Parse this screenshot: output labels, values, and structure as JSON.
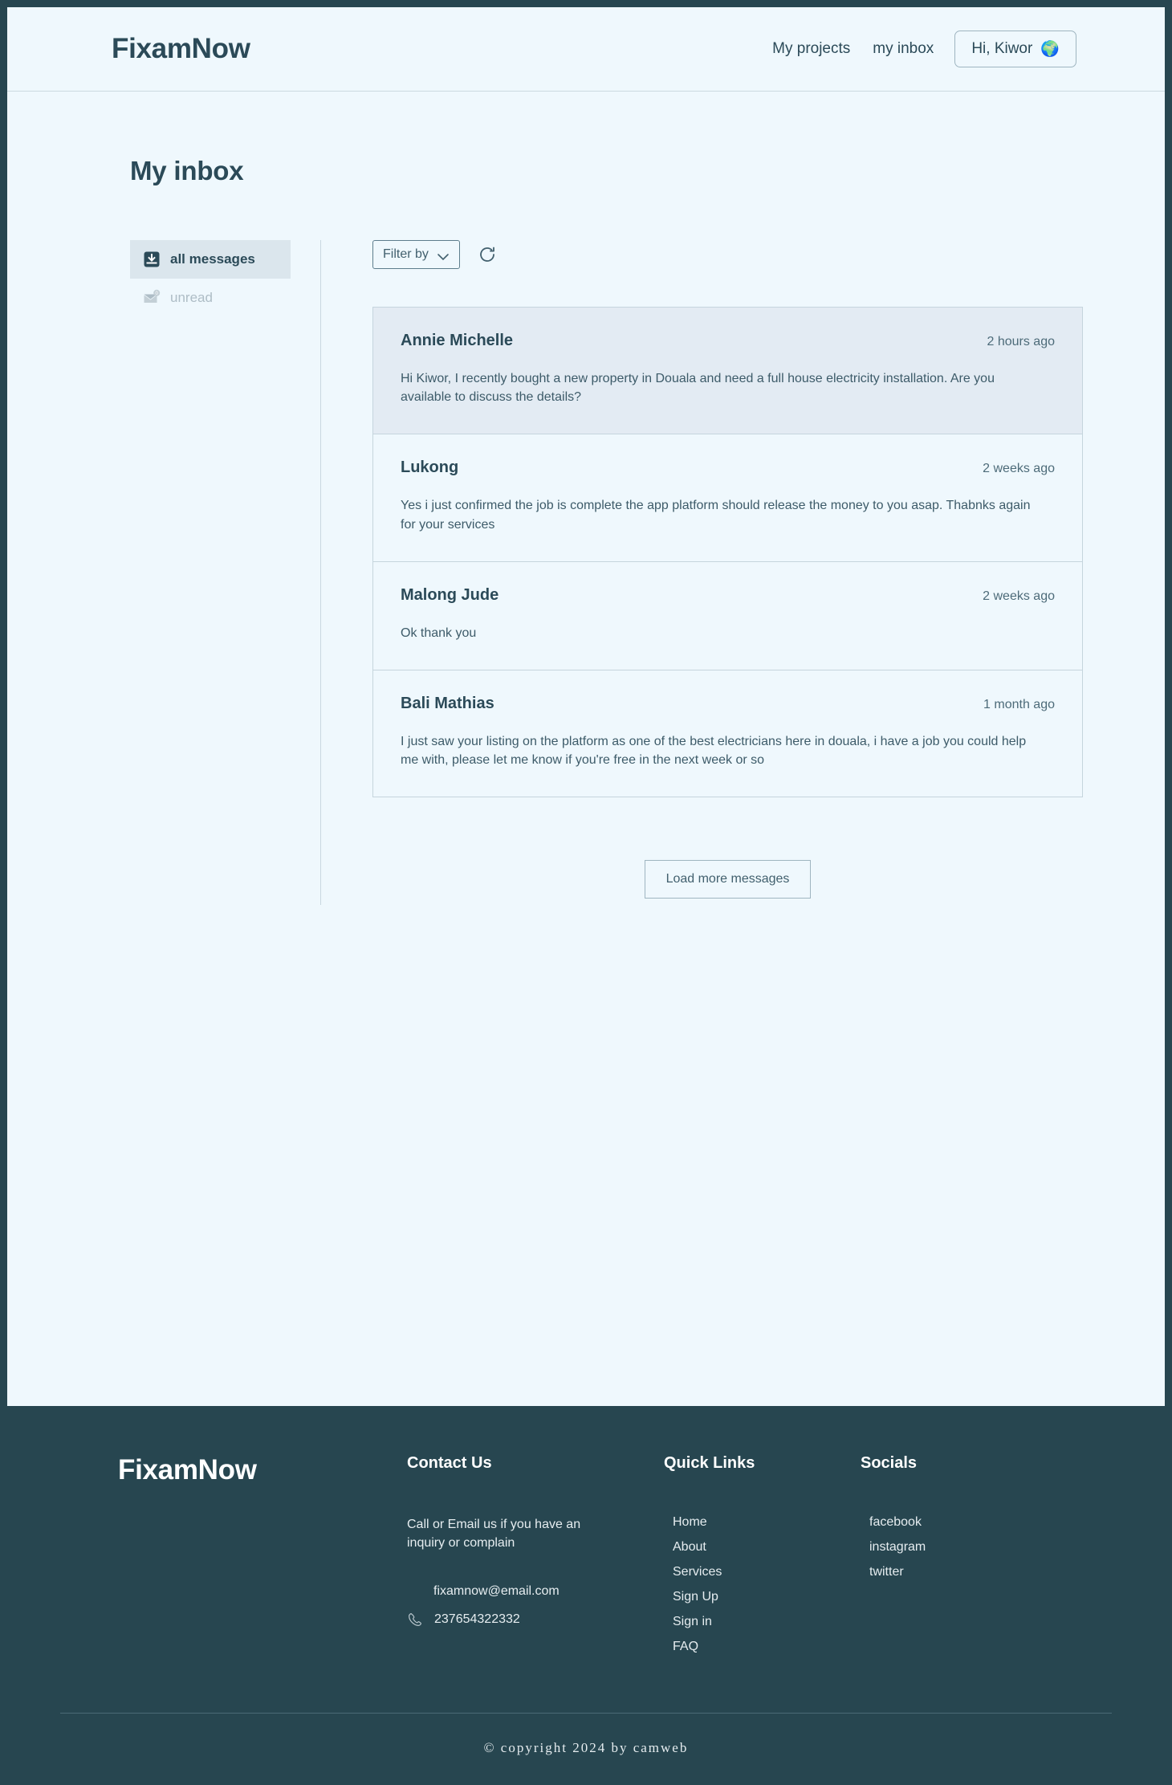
{
  "header": {
    "brand": "FixamNow",
    "nav": [
      {
        "label": "My projects",
        "name": "nav-my-projects"
      },
      {
        "label": "my inbox",
        "name": "nav-my-inbox"
      }
    ],
    "user_chip": {
      "label": "Hi, Kiwor",
      "avatar": "🌍"
    }
  },
  "main": {
    "page_title": "My inbox",
    "sidebar": {
      "items": [
        {
          "label": "all messages",
          "icon": "inbox-icon",
          "active": true
        },
        {
          "label": "unread",
          "icon": "envelope-badge-icon",
          "badge": "0",
          "active": false
        }
      ]
    },
    "toolbar": {
      "filter_label": "Filter by",
      "refresh_icon": "refresh-icon"
    },
    "messages": [
      {
        "sender": "Annie Michelle",
        "time": "2 hours ago",
        "body": "Hi Kiwor, I recently bought a new property in Douala and need a full house electricity installation. Are you available to discuss the details?",
        "unread": true
      },
      {
        "sender": "Lukong",
        "time": "2 weeks ago",
        "body": "Yes i just confirmed the job is complete the app platform should release the money to you asap. Thabnks again for your services",
        "unread": false
      },
      {
        "sender": "Malong Jude",
        "time": "2 weeks ago",
        "body": "Ok thank you",
        "unread": false
      },
      {
        "sender": "Bali Mathias",
        "time": "1 month ago",
        "body": "I just saw your listing on the platform as one of the best electricians here in douala, i have a job you could help me with, please let me know if you're free in the next week or so",
        "unread": false
      }
    ],
    "load_more_label": "Load more messages"
  },
  "footer": {
    "brand": "FixamNow",
    "contact": {
      "heading": "Contact Us",
      "text": "Call or Email us if you have an inquiry or complain",
      "email": "fixamnow@email.com",
      "phone": "237654322332"
    },
    "quick_links": {
      "heading": "Quick Links",
      "items": [
        "Home",
        "About",
        "Services",
        "Sign Up",
        "Sign in",
        "FAQ"
      ]
    },
    "socials": {
      "heading": "Socials",
      "items": [
        "facebook",
        "instagram",
        "twitter"
      ]
    },
    "copyright": "© copyright 2024 by camweb"
  },
  "colors": {
    "dark": "#274650",
    "page_bg": "#eff8fd",
    "unread_card": "#e3ebf3",
    "active_side": "#dbe6ed",
    "border": "#c5d5dd"
  }
}
